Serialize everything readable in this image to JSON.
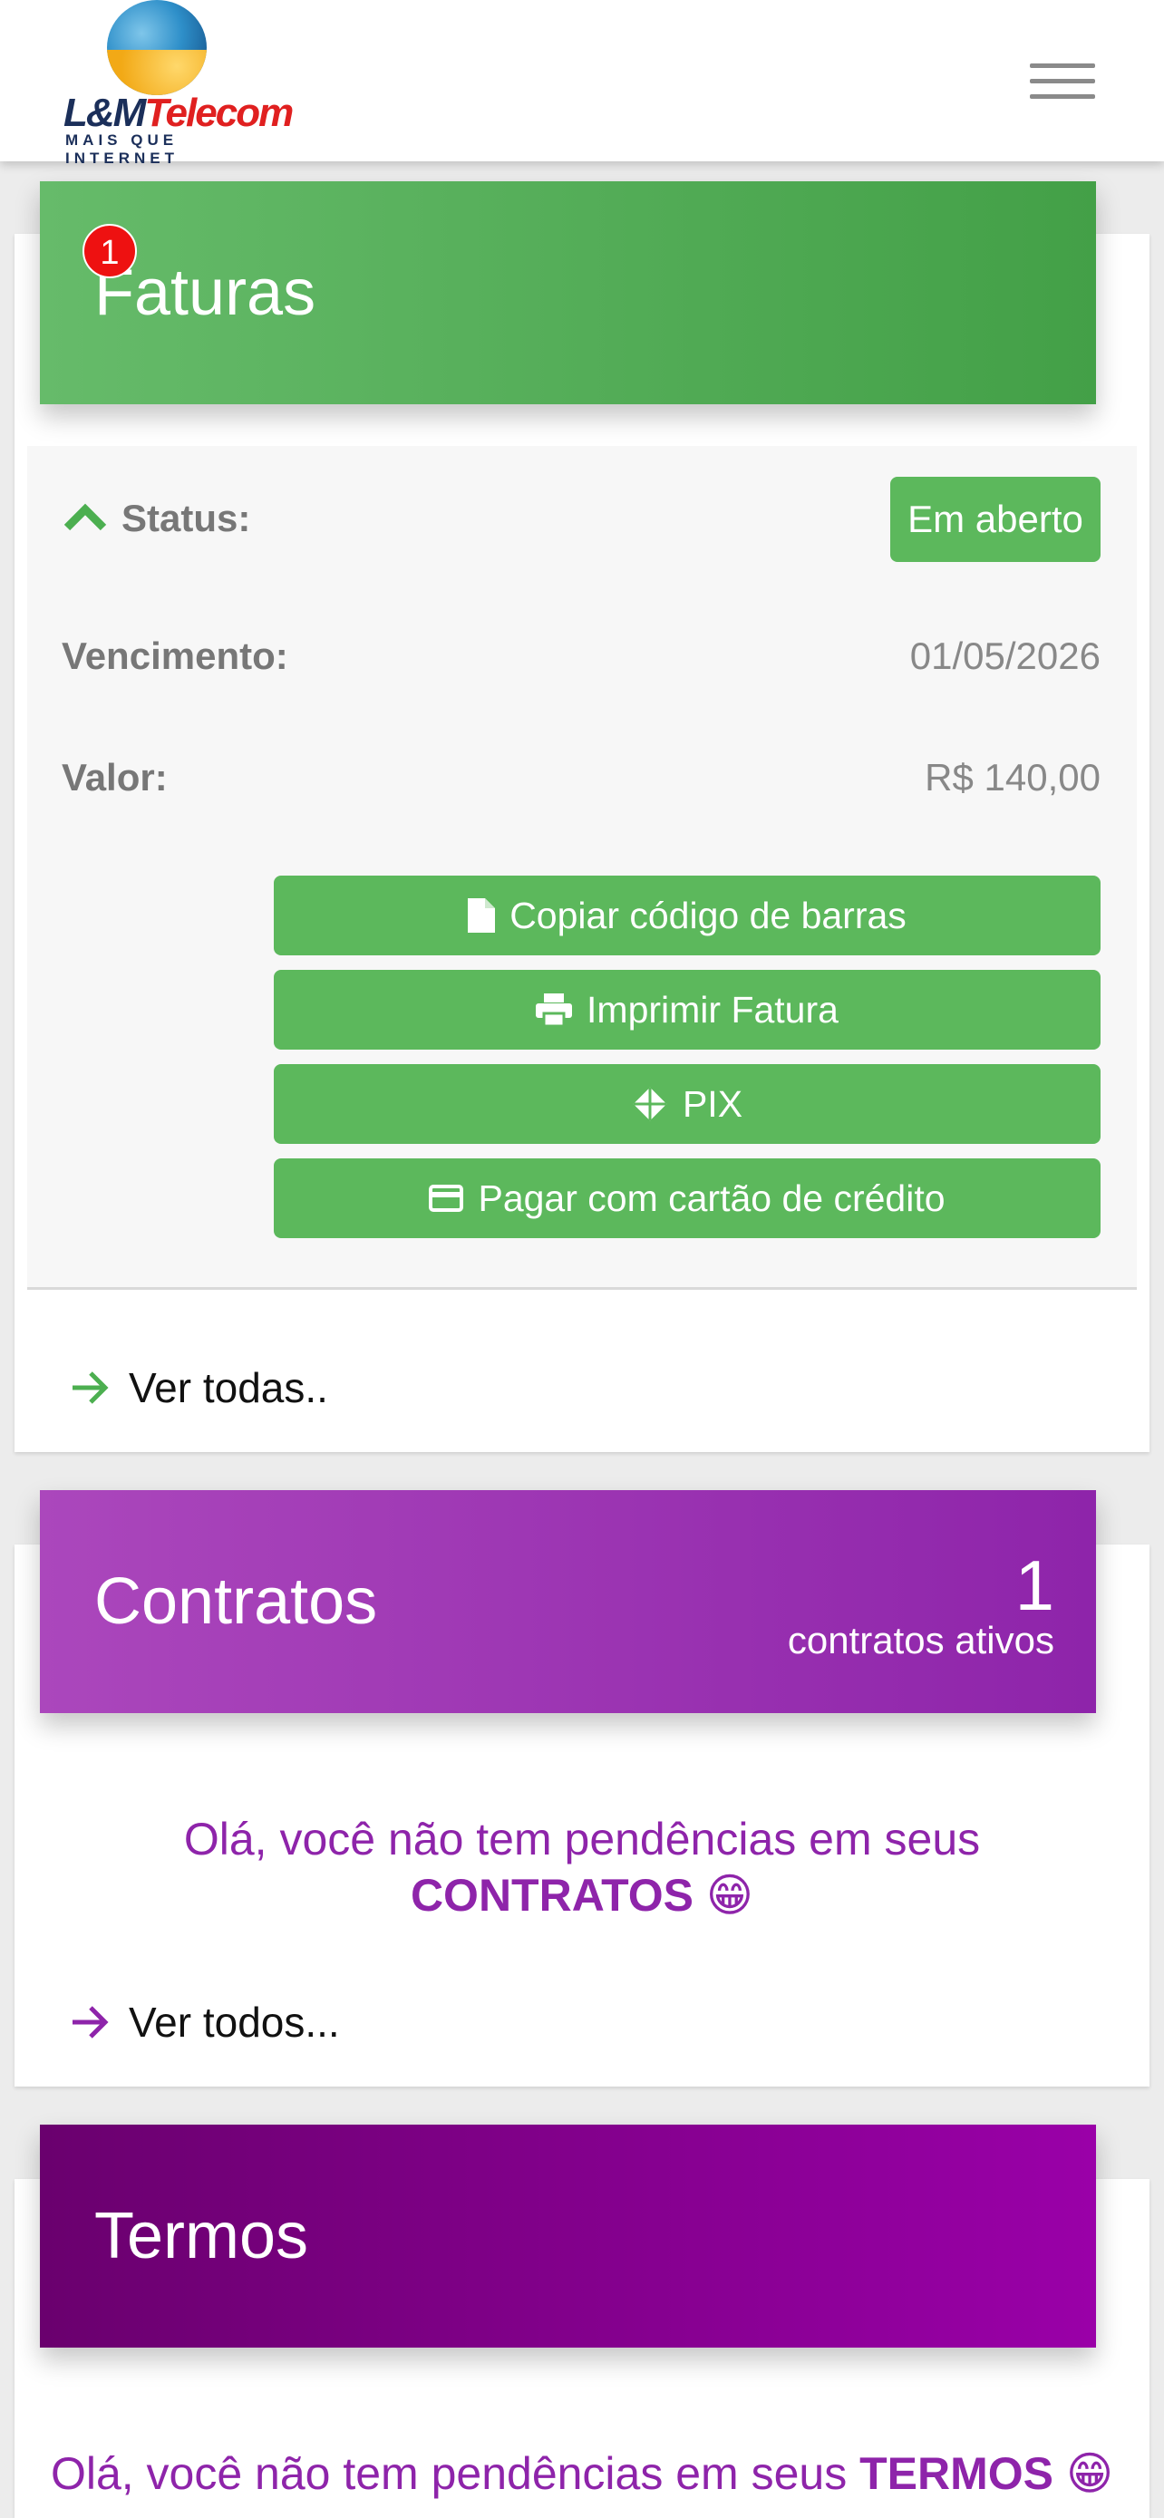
{
  "header": {
    "logo_brand_a": "L&M",
    "logo_brand_b": "Telecom",
    "logo_tagline": "MAIS QUE INTERNET",
    "menu_icon": "hamburger-icon"
  },
  "faturas": {
    "title": "Faturas",
    "badge": "1",
    "status_label": "Status:",
    "status_value": "Em aberto",
    "due_label": "Vencimento:",
    "due_value": "01/05/2026",
    "amount_label": "Valor:",
    "amount_value": "R$ 140,00",
    "buttons": [
      {
        "label": "Copiar código de barras",
        "icon": "file-icon"
      },
      {
        "label": "Imprimir Fatura",
        "icon": "printer-icon"
      },
      {
        "label": "PIX",
        "icon": "pix-icon"
      },
      {
        "label": "Pagar com cartão de crédito",
        "icon": "credit-card-icon"
      }
    ],
    "see_all": "Ver todas.."
  },
  "contratos": {
    "title": "Contratos",
    "count": "1",
    "count_label": "contratos ativos",
    "message_a": "Olá, você não tem pendências em seus",
    "message_b": "CONTRATOS",
    "emoji": "😁",
    "see_all": "Ver todos..."
  },
  "termos": {
    "title": "Termos",
    "message_a": "Olá, você não tem pendências em seus",
    "message_b": "TERMOS",
    "emoji": "😁"
  },
  "colors": {
    "green": "#5cb85c",
    "purple": "#8e24aa",
    "dark_purple": "#800080",
    "badge_red": "#ee1111"
  }
}
